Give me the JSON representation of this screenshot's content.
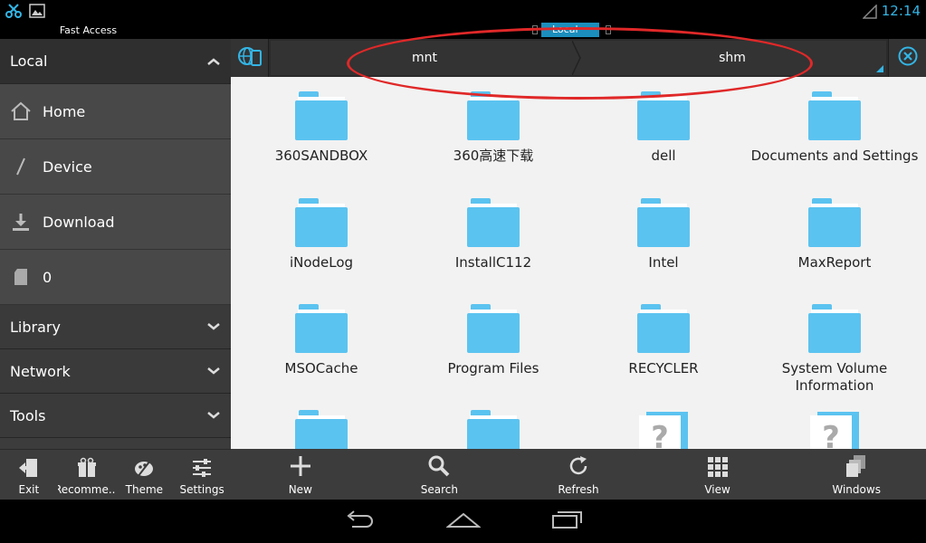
{
  "status": {
    "time": "12:14"
  },
  "sidebar": {
    "title": "Fast Access",
    "local_header": "Local",
    "items": [
      {
        "label": "Home",
        "icon": "home-icon"
      },
      {
        "label": "Device",
        "icon": "slash-icon"
      },
      {
        "label": "Download",
        "icon": "download-icon"
      },
      {
        "label": "0",
        "icon": "sd-card-icon"
      }
    ],
    "sections": [
      "Library",
      "Network",
      "Tools"
    ],
    "bottom": [
      {
        "label": "Exit",
        "icon": "exit-icon"
      },
      {
        "label": "Recomme...",
        "icon": "gift-icon"
      },
      {
        "label": "Theme",
        "icon": "palette-icon"
      },
      {
        "label": "Settings",
        "icon": "sliders-icon"
      }
    ]
  },
  "pathbar": {
    "tab_label": "Local",
    "crumbs": [
      "mnt",
      "shm"
    ]
  },
  "files": [
    {
      "name": "360SANDBOX",
      "type": "folder"
    },
    {
      "name": "360高速下载",
      "type": "folder"
    },
    {
      "name": "dell",
      "type": "folder"
    },
    {
      "name": "Documents and Settings",
      "type": "folder"
    },
    {
      "name": "iNodeLog",
      "type": "folder"
    },
    {
      "name": "InstallC112",
      "type": "folder"
    },
    {
      "name": "Intel",
      "type": "folder"
    },
    {
      "name": "MaxReport",
      "type": "folder"
    },
    {
      "name": "MSOCache",
      "type": "folder"
    },
    {
      "name": "Program Files",
      "type": "folder"
    },
    {
      "name": "RECYCLER",
      "type": "folder"
    },
    {
      "name": "System Volume Information",
      "type": "folder"
    },
    {
      "name": "",
      "type": "folder"
    },
    {
      "name": "",
      "type": "folder"
    },
    {
      "name": "",
      "type": "unknown"
    },
    {
      "name": "",
      "type": "unknown"
    }
  ],
  "toolbar": [
    {
      "label": "New",
      "icon": "plus-icon"
    },
    {
      "label": "Search",
      "icon": "search-icon"
    },
    {
      "label": "Refresh",
      "icon": "refresh-icon"
    },
    {
      "label": "View",
      "icon": "grid-icon"
    },
    {
      "label": "Windows",
      "icon": "windows-icon"
    }
  ],
  "colors": {
    "accent": "#33b5e5",
    "folder": "#5bc3f0",
    "annotation": "#e02828"
  }
}
